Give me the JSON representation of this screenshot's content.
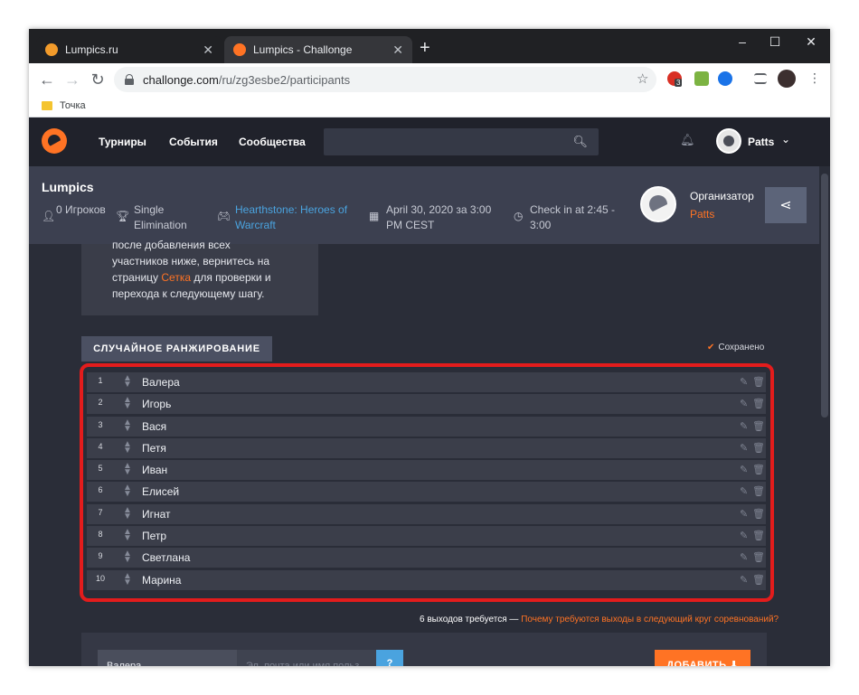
{
  "browser": {
    "tabs": [
      {
        "title": "Lumpics.ru",
        "favicon_color": "#f29b2b"
      },
      {
        "title": "Lumpics - Challonge",
        "favicon_color": "#ff7324"
      }
    ],
    "new_tab": "+",
    "window_controls": {
      "minimize": "–",
      "maximize": "☐",
      "close": "✕"
    },
    "nav": {
      "back": "←",
      "forward": "→",
      "reload": "↻"
    },
    "url": "challonge.com/ru/zg3esbe2/participants",
    "extension_badge": "3",
    "bookmark": "Точка"
  },
  "site": {
    "nav": [
      "Турниры",
      "События",
      "Сообщества"
    ],
    "user": "Patts"
  },
  "tournament": {
    "title": "Lumpics",
    "players": "0 Игроков",
    "format": "Single Elimination",
    "game": "Hearthstone: Heroes of Warcraft",
    "date": "April 30, 2020 за 3:00 PM CEST",
    "checkin": "Check in at 2:45 - 3:00",
    "organizer_label": "Организатор",
    "organizer_name": "Patts"
  },
  "info": {
    "line1": "после добавления всех",
    "line2": "участников ниже, вернитесь на",
    "line3_before": "страницу ",
    "line3_link": "Сетка",
    "line3_after": " для проверки и",
    "line4": "перехода к следующему шагу."
  },
  "section": {
    "title": "СЛУЧАЙНОЕ РАНЖИРОВАНИЕ",
    "saved": "Сохранено"
  },
  "participants": [
    {
      "seed": "1",
      "name": "Валера"
    },
    {
      "seed": "2",
      "name": "Игорь"
    },
    {
      "seed": "3",
      "name": "Вася"
    },
    {
      "seed": "4",
      "name": "Петя"
    },
    {
      "seed": "5",
      "name": "Иван"
    },
    {
      "seed": "6",
      "name": "Елисей"
    },
    {
      "seed": "7",
      "name": "Игнат"
    },
    {
      "seed": "8",
      "name": "Петр"
    },
    {
      "seed": "9",
      "name": "Светлана"
    },
    {
      "seed": "10",
      "name": "Марина"
    }
  ],
  "footnote": {
    "text": "6 выходов требуется — ",
    "link": "Почему требуются выходы в следующий круг соревнований?"
  },
  "add_form": {
    "name_value": "Валера",
    "email_placeholder": "Эл. почта или имя польз.",
    "help": "?",
    "button": "ДОБАВИТЬ ⬇"
  },
  "colors": {
    "accent": "#ff7324",
    "link": "#4aa3df",
    "highlight": "#e31c1c"
  }
}
